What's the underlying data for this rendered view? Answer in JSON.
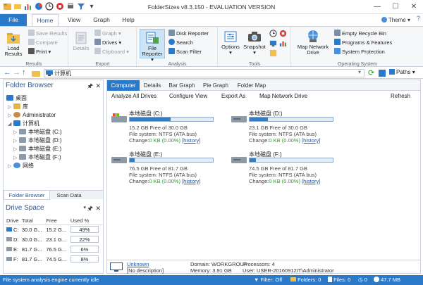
{
  "window": {
    "title": "FolderSizes v8.3.150 - EVALUATION VERSION",
    "minimize": "—",
    "maximize": "☐",
    "close": "✕"
  },
  "ribbon_tabs": {
    "file": "File",
    "items": [
      "Home",
      "View",
      "Graph",
      "Help"
    ],
    "theme": "Theme"
  },
  "ribbon": {
    "results": {
      "label": "Results",
      "load_results": "Load\nResults",
      "save_results": "Save Results",
      "compare": "Compare",
      "print": "Print"
    },
    "export": {
      "label": "Export",
      "details": "Details",
      "graph": "Graph",
      "drives": "Drives",
      "clipboard": "Clipboard"
    },
    "analysis": {
      "label": "Analysis",
      "file_reporter": "File\nReporter",
      "disk_reporter": "Disk Reporter",
      "search": "Search",
      "scan_filter": "Scan Filter"
    },
    "tools": {
      "label": "Tools",
      "options": "Options",
      "snapshot": "Snapshot"
    },
    "operating_system": {
      "label": "Operating System",
      "map_network_drive": "Map Network\nDrive",
      "empty_recycle_bin": "Empty Recycle Bin",
      "programs_features": "Programs & Features",
      "system_protection": "System Protection"
    }
  },
  "addressbar": {
    "value": "计算机",
    "paths": "Paths"
  },
  "folder_browser": {
    "title": "Folder Browser",
    "items": [
      {
        "label": "桌面",
        "level": 0
      },
      {
        "label": "库",
        "level": 1
      },
      {
        "label": "Administrator",
        "level": 1
      },
      {
        "label": "计算机",
        "level": 1
      },
      {
        "label": "本地磁盘 (C:)",
        "level": 2
      },
      {
        "label": "本地磁盘 (D:)",
        "level": 2
      },
      {
        "label": "本地磁盘 (E:)",
        "level": 2
      },
      {
        "label": "本地磁盘 (F:)",
        "level": 2
      },
      {
        "label": "网络",
        "level": 1
      }
    ],
    "tabs": [
      "Folder Browser",
      "Scan Data"
    ]
  },
  "drive_space": {
    "title": "Drive Space",
    "columns": [
      "Drive",
      "Total",
      "Free",
      "Used %"
    ],
    "rows": [
      {
        "drive": "C:",
        "total": "30.0 G...",
        "free": "15.2 G...",
        "used": "49%"
      },
      {
        "drive": "D:",
        "total": "30.0 G...",
        "free": "23.1 G...",
        "used": "22%"
      },
      {
        "drive": "E:",
        "total": "81.7 G...",
        "free": "76.5 G...",
        "used": "6%"
      },
      {
        "drive": "F:",
        "total": "81.7 G...",
        "free": "74.5 G...",
        "used": "8%"
      }
    ]
  },
  "content_tabs": [
    "Computer",
    "Details",
    "Bar Graph",
    "Pie Graph",
    "Folder Map"
  ],
  "content_toolbar": {
    "analyze_all": "Analyze All Drives",
    "configure_view": "Configure View",
    "export_as": "Export As",
    "map_network_drive": "Map Network Drive",
    "refresh": "Refresh"
  },
  "drives": [
    {
      "name": "本地磁盘 (C:)",
      "free": "15.2 GB Free of 30.0 GB",
      "fs": "File system: NTFS (ATA bus)",
      "change": "Change:",
      "change_val": "0 KB (0.00%)",
      "history": "[history]",
      "used_fraction": 0.49
    },
    {
      "name": "本地磁盘 (D:)",
      "free": "23.1 GB Free of 30.0 GB",
      "fs": "File system: NTFS (ATA bus)",
      "change": "Change:",
      "change_val": "0 KB (0.00%)",
      "history": "[history]",
      "used_fraction": 0.22
    },
    {
      "name": "本地磁盘 (E:)",
      "free": "76.5 GB Free of 81.7 GB",
      "fs": "File system: NTFS (ATA bus)",
      "change": "Change:",
      "change_val": "0 KB (0.00%)",
      "history": "[history]",
      "used_fraction": 0.06
    },
    {
      "name": "本地磁盘 (F:)",
      "free": "74.5 GB Free of 81.7 GB",
      "fs": "File system: NTFS (ATA bus)",
      "change": "Change:",
      "change_val": "0 KB (0.00%)",
      "history": "[history]",
      "used_fraction": 0.08
    }
  ],
  "info_panel": {
    "unknown": "Unknown",
    "no_description": "[No description]",
    "domain": "Domain: WORKGROUP",
    "memory": "Memory: 3.91 GB",
    "processors": "Processors: 4",
    "user": "User: USER-20160912IT\\Administrator"
  },
  "statusbar": {
    "message": "File system analysis engine currently idle",
    "filter": "Filter: Off",
    "folders": "Folders: 0",
    "files": "Files: 0",
    "zero": "0",
    "memory": "47.7 MB"
  },
  "colors": {
    "accent": "#2b79c9",
    "title_accent": "#2b5797",
    "bar_fill": "#2f7fcf"
  }
}
